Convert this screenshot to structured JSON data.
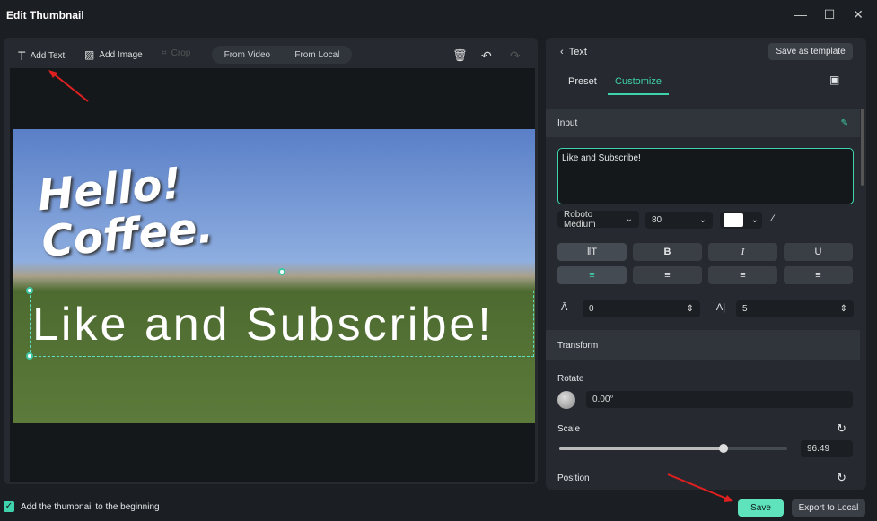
{
  "window": {
    "title": "Edit Thumbnail"
  },
  "toolbar": {
    "add_text": "Add Text",
    "add_image": "Add Image",
    "crop": "Crop",
    "from_video": "From Video",
    "from_local": "From Local"
  },
  "canvas": {
    "text_1": "Hello!",
    "text_2": "Coffee.",
    "text_3": "Like and Subscribe!"
  },
  "panel": {
    "back_label": "Text",
    "save_template": "Save as template",
    "tabs": [
      "Preset",
      "Customize"
    ],
    "active_tab": "Customize",
    "input_section": "Input",
    "input_value": "Like and Subscribe!",
    "font": "Roboto Medium",
    "size": "80",
    "color": "#ffffff",
    "style_buttons": [
      "B",
      "I",
      "U"
    ],
    "line_spacing": "0",
    "char_spacing": "5",
    "transform_section": "Transform",
    "rotate_label": "Rotate",
    "rotate_value": "0.00°",
    "scale_label": "Scale",
    "scale_value": "96.49",
    "scale_percent": 72,
    "position_label": "Position"
  },
  "footer": {
    "checkbox_label": "Add the thumbnail to the beginning",
    "checked": true,
    "save": "Save",
    "export": "Export to Local"
  },
  "colors": {
    "accent": "#3fd3ad",
    "bg": "#1b1e22",
    "panel": "#262a30"
  }
}
